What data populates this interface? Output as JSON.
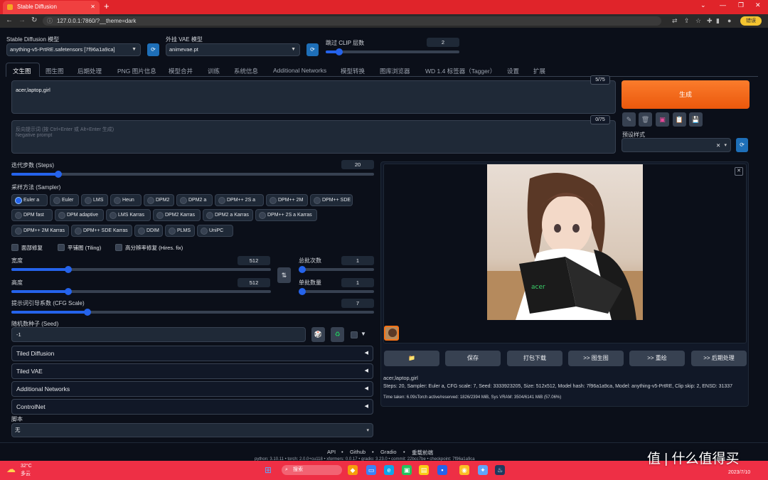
{
  "browser": {
    "tab_title": "Stable Diffusion",
    "url": "127.0.0.1:7860/?__theme=dark",
    "error_badge": "错误"
  },
  "settings": {
    "model_label": "Stable Diffusion 模型",
    "model_value": "anything-v5-PrtRE.safetensors [7f96a1a9ca]",
    "vae_label": "外挂 VAE 模型",
    "vae_value": "animevae.pt",
    "clip_label": "跳过 CLIP 层数",
    "clip_value": "2",
    "clip_fraction": 0.1
  },
  "tabs": [
    "文生图",
    "图生图",
    "后期处理",
    "PNG 图片信息",
    "模型合并",
    "训练",
    "系统信息",
    "Additional Networks",
    "模型转换",
    "图库浏览器",
    "WD 1.4 标签器（Tagger）",
    "设置",
    "扩展"
  ],
  "prompt": {
    "positive": "acer,laptop,girl",
    "positive_count": "5/75",
    "negative_placeholder": "反向提示词 (按 Ctrl+Enter 或 Alt+Enter 生成)",
    "negative_sub": "Negative prompt",
    "negative_count": "0/75"
  },
  "generate": {
    "label": "生成",
    "style_label": "预设样式"
  },
  "tool_buttons": [
    "pencil-icon",
    "trash-icon",
    "image-icon",
    "clipboard-icon",
    "save-icon"
  ],
  "params": {
    "steps_label": "迭代步数 (Steps)",
    "steps_value": "20",
    "steps_fraction": 0.13,
    "sampler_label": "采样方法 (Sampler)",
    "samplers_row1": [
      "Euler a",
      "Euler",
      "LMS",
      "Heun",
      "DPM2",
      "DPM2 a",
      "DPM++ 2S a",
      "DPM++ 2M",
      "DPM++ SDE"
    ],
    "samplers_row2": [
      "DPM fast",
      "DPM adaptive",
      "LMS Karras",
      "DPM2 Karras",
      "DPM2 a Karras",
      "DPM++ 2S a Karras"
    ],
    "samplers_row3": [
      "DPM++ 2M Karras",
      "DPM++ SDE Karras",
      "DDIM",
      "PLMS",
      "UniPC"
    ],
    "selected_sampler": "Euler a",
    "restore_faces": "面部修复",
    "tiling": "平铺图 (Tiling)",
    "hires": "高分辨率修复 (Hires. fix)",
    "width_label": "宽度",
    "width_value": "512",
    "width_fraction": 0.22,
    "height_label": "高度",
    "height_value": "512",
    "height_fraction": 0.22,
    "batch_count_label": "总批次数",
    "batch_count_value": "1",
    "batch_size_label": "单批数量",
    "batch_size_value": "1",
    "cfg_label": "提示词引导系数 (CFG Scale)",
    "cfg_value": "7",
    "cfg_fraction": 0.21,
    "seed_label": "随机数种子 (Seed)",
    "seed_value": "-1"
  },
  "accordions": [
    "Tiled Diffusion",
    "Tiled VAE",
    "Additional Networks",
    "ControlNet"
  ],
  "script": {
    "label": "脚本",
    "value": "无"
  },
  "output": {
    "buttons": [
      "保存",
      "打包下载",
      ">> 图生图",
      ">> 重绘",
      ">> 后期处理"
    ],
    "info_prompt": "acer,laptop,girl",
    "info_params": "Steps: 20, Sampler: Euler a, CFG scale: 7, Seed: 3333923205, Size: 512x512, Model hash: 7f96a1a9ca, Model: anything-v5-PrtRE, Clip skip: 2, ENSD: 31337",
    "info_time": "Time taken: 6.09sTorch active/reserved: 1826/2394 MiB, Sys VRAM: 3504/6141 MiB (57.06%)"
  },
  "footer": {
    "links": [
      "API",
      "Github",
      "Gradio",
      "重载前端"
    ],
    "versions": "python: 3.10.11  •  torch: 2.0.0+cu118  •  xformers: 0.0.17  •  gradio: 3.23.0  •  commit: 22bcc7be  •  checkpoint: 7f96a1a9ca"
  },
  "taskbar": {
    "weather_temp": "32°C",
    "weather_desc": "多云",
    "search": "搜索",
    "time": "",
    "date": "2023/7/10"
  },
  "watermark": "值 | 什么值得买",
  "colors": {
    "accent_orange": "#ea580c",
    "accent_blue": "#2563eb",
    "background": "#0b0f19",
    "chrome_red": "#e0242a"
  }
}
